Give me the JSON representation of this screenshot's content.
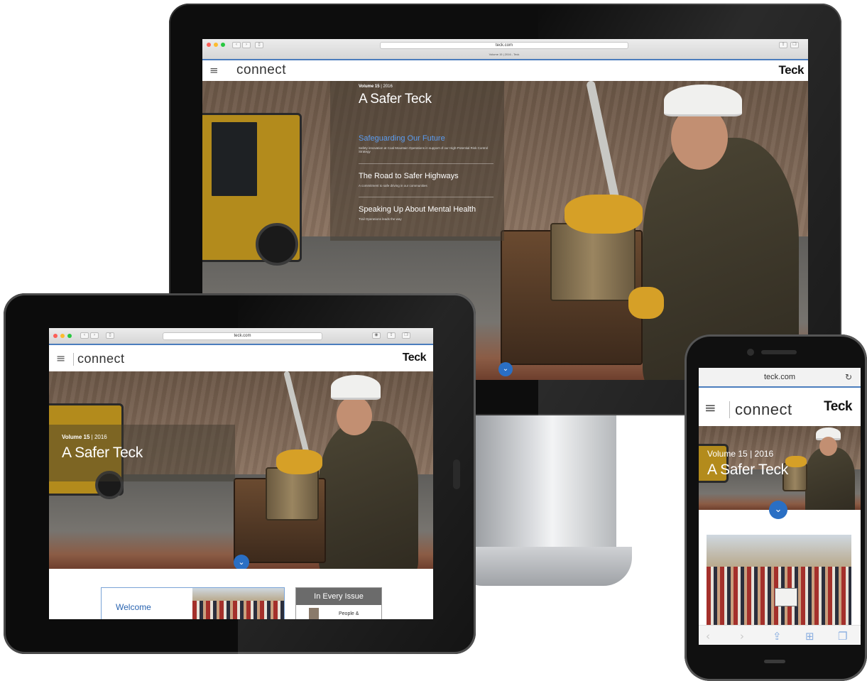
{
  "browser": {
    "url": "teck.com",
    "tab_title": "Volume 15 | 2016 - Teck"
  },
  "site": {
    "brand": "connect",
    "logo": "Teck",
    "menu_icon": "hamburger-icon"
  },
  "hero": {
    "volume_label": "Volume 15",
    "year": "| 2016",
    "title": "A Safer Teck",
    "scroll_icon": "chevron-down-icon"
  },
  "stories": [
    {
      "title": "Safeguarding Our Future",
      "subtitle": "Safety innovation at Coal Mountain Operations in support of our High-Potential Risk Control Strategy"
    },
    {
      "title": "The Road to Safer Highways",
      "subtitle": "A commitment to safe driving in our communities"
    },
    {
      "title": "Speaking Up About Mental Health",
      "subtitle": "Trail Operations leads the way"
    }
  ],
  "tablet_content": {
    "welcome": "Welcome",
    "in_every_issue": "In Every Issue",
    "people_item": "People &"
  },
  "phone_toolbar": {
    "icons": [
      "back-arrow-icon",
      "forward-arrow-icon",
      "share-icon",
      "bookmarks-icon",
      "tabs-icon"
    ]
  },
  "colors": {
    "accent_blue": "#2a6fc4",
    "chrome_rule": "#4b7dbd",
    "active_story": "#5b9cf0"
  }
}
